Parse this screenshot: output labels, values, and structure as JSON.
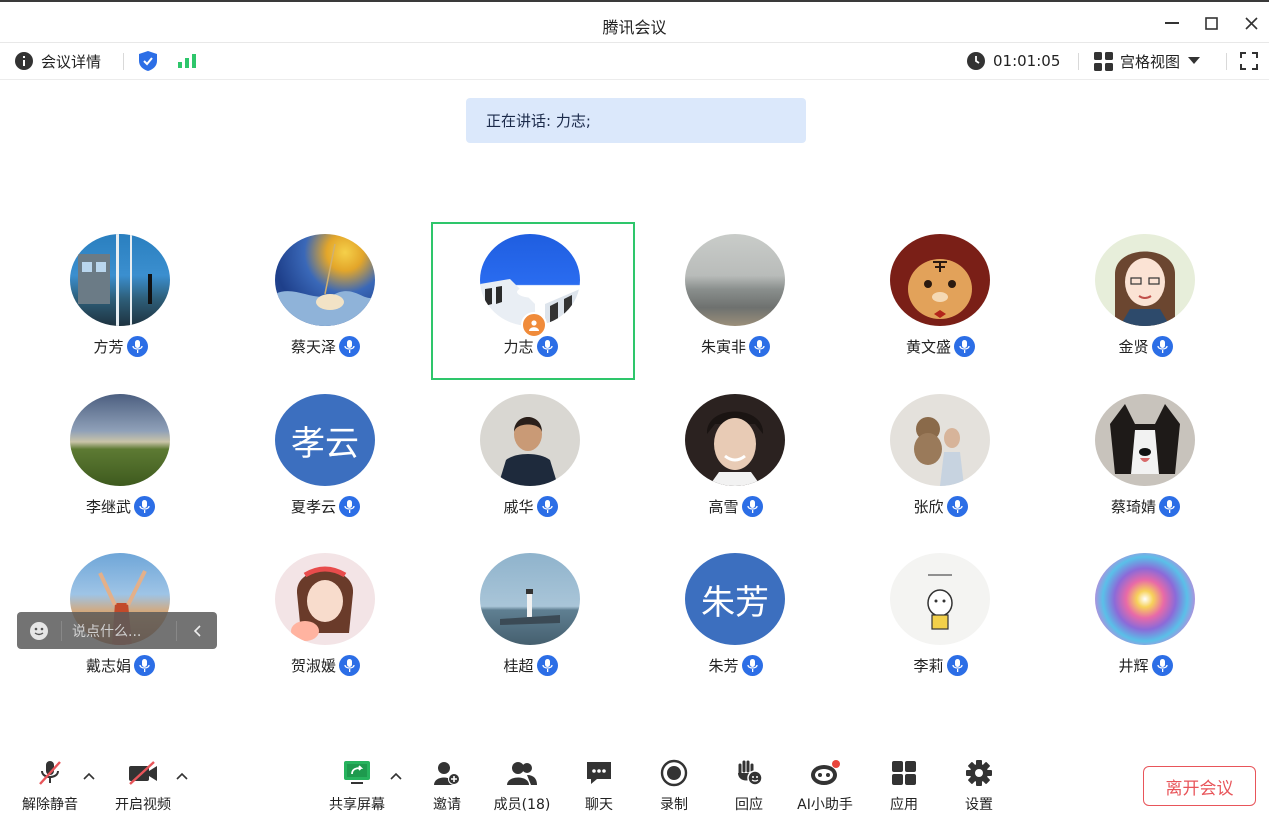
{
  "window": {
    "title": "腾讯会议"
  },
  "topbar": {
    "meeting_details": "会议详情",
    "timer": "01:01:05",
    "view_mode": "宫格视图"
  },
  "speaking_banner": "正在讲话: 力志;",
  "participants": [
    {
      "name": "方芳"
    },
    {
      "name": "蔡天泽"
    },
    {
      "name": "力志"
    },
    {
      "name": "朱寅非"
    },
    {
      "name": "黄文盛"
    },
    {
      "name": "金贤"
    },
    {
      "name": "李继武"
    },
    {
      "name": "夏孝云",
      "avatar_text": "孝云"
    },
    {
      "name": "戚华"
    },
    {
      "name": "高雪"
    },
    {
      "name": "张欣"
    },
    {
      "name": "蔡琦婧"
    },
    {
      "name": "戴志娟"
    },
    {
      "name": "贺淑媛"
    },
    {
      "name": "桂超"
    },
    {
      "name": "朱芳",
      "avatar_text": "朱芳"
    },
    {
      "name": "李莉"
    },
    {
      "name": "井辉"
    }
  ],
  "chat_input": {
    "placeholder": "说点什么..."
  },
  "toolbar": {
    "unmute": "解除静音",
    "start_video": "开启视频",
    "share_screen": "共享屏幕",
    "invite": "邀请",
    "members": "成员(18)",
    "chat": "聊天",
    "record": "录制",
    "react": "回应",
    "ai_assistant": "AI小助手",
    "apps": "应用",
    "settings": "设置",
    "leave": "离开会议"
  },
  "colors": {
    "accent_blue": "#2c6ee6",
    "active_speaker_border": "#2ec66b",
    "leave_red": "#e8555a",
    "banner_bg": "#dbe8fb"
  }
}
